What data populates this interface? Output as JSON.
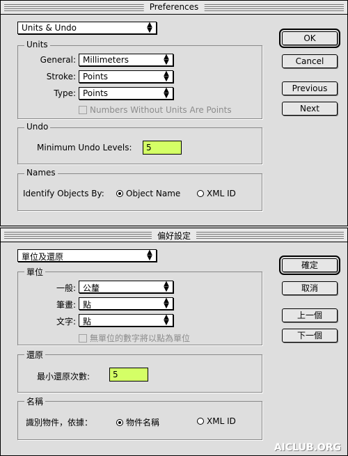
{
  "en": {
    "title": "Preferences",
    "category": "Units & Undo",
    "units_group": "Units",
    "general_label": "General:",
    "general_value": "Millimeters",
    "stroke_label": "Stroke:",
    "stroke_value": "Points",
    "type_label": "Type:",
    "type_value": "Points",
    "numbers_checkbox": "Numbers Without Units Are Points",
    "undo_group": "Undo",
    "min_undo_label": "Minimum Undo Levels:",
    "min_undo_value": "5",
    "names_group": "Names",
    "identify_label": "Identify Objects By:",
    "radio_object_name": "Object Name",
    "radio_xml_id": "XML ID",
    "ok": "OK",
    "cancel": "Cancel",
    "previous": "Previous",
    "next": "Next"
  },
  "zh": {
    "title": "偏好設定",
    "category": "單位及還原",
    "units_group": "單位",
    "general_label": "一般:",
    "general_value": "公釐",
    "stroke_label": "筆畫:",
    "stroke_value": "點",
    "type_label": "文字:",
    "type_value": "點",
    "numbers_checkbox": "無單位的數字將以點為單位",
    "undo_group": "還原",
    "min_undo_label": "最小還原次數:",
    "min_undo_value": "5",
    "names_group": "名稱",
    "identify_label": "識別物件，依據：",
    "radio_object_name": "物件名稱",
    "radio_xml_id": "XML ID",
    "ok": "確定",
    "cancel": "取消",
    "previous": "上一個",
    "next": "下一個"
  },
  "watermark": "AICLUB.ORG",
  "colors": {
    "field_bg": "#d4ff66",
    "dialog_bg": "#dedede"
  }
}
